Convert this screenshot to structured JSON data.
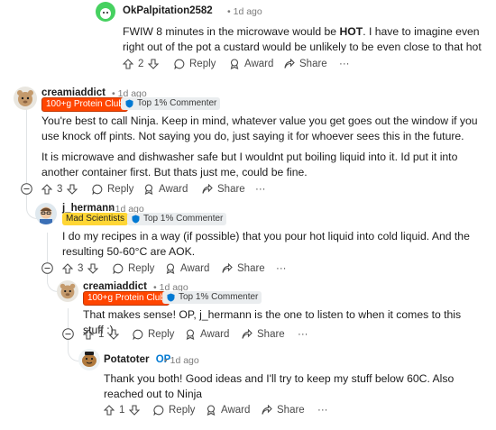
{
  "comments": [
    {
      "username": "OkPalpitation2582",
      "time": "1d ago",
      "body_before": "FWIW 8 minutes in the microwave would be ",
      "body_bold": "HOT",
      "body_after": ". I have to imagine even right out of the pot a custard would be unlikely to be even close to that hot",
      "votes": "2",
      "reply": "Reply",
      "award": "Award",
      "share": "Share",
      "more": "···",
      "avatar_color": "#46d160"
    },
    {
      "username": "creamiaddict",
      "time": "1d ago",
      "flair": "100+g Protein Club",
      "badge": "Top 1% Commenter",
      "para1": "You're best to call Ninja. Keep in mind, whatever value you get goes out the window if you use knock off pints. Not saying you do, just saying it for whoever sees this in the future.",
      "para2": "It is microwave and dishwasher safe but I wouldnt put boiling liquid into it. Id put it into another container first. But thats just me, could be fine.",
      "votes": "3",
      "reply": "Reply",
      "award": "Award",
      "share": "Share",
      "more": "···"
    },
    {
      "username": "j_hermann",
      "time": "1d ago",
      "flair": "Mad Scientists",
      "badge": "Top 1% Commenter",
      "body": "I do my recipes in a way (if possible) that you pour hot liquid into cold liquid. And the resulting 50-60°C are AOK.",
      "votes": "3",
      "reply": "Reply",
      "award": "Award",
      "share": "Share",
      "more": "···"
    },
    {
      "username": "creamiaddict",
      "time": "1d ago",
      "flair": "100+g Protein Club",
      "badge": "Top 1% Commenter",
      "body": "That makes sense! OP, j_hermann is the one to listen to when it comes to this stuff :)",
      "votes": "1",
      "reply": "Reply",
      "award": "Award",
      "share": "Share",
      "more": "···"
    },
    {
      "username": "Potatoter",
      "op": "OP",
      "time": "1d ago",
      "body": "Thank you both! Good ideas and I'll try to keep my stuff below 60C. Also reached out to Ninja",
      "votes": "1",
      "reply": "Reply",
      "award": "Award",
      "share": "Share",
      "more": "···"
    }
  ],
  "separator": "•",
  "colors": {
    "accent_red": "#ff4500",
    "flair_yellow": "#ffd635",
    "op_blue": "#0079d3"
  }
}
